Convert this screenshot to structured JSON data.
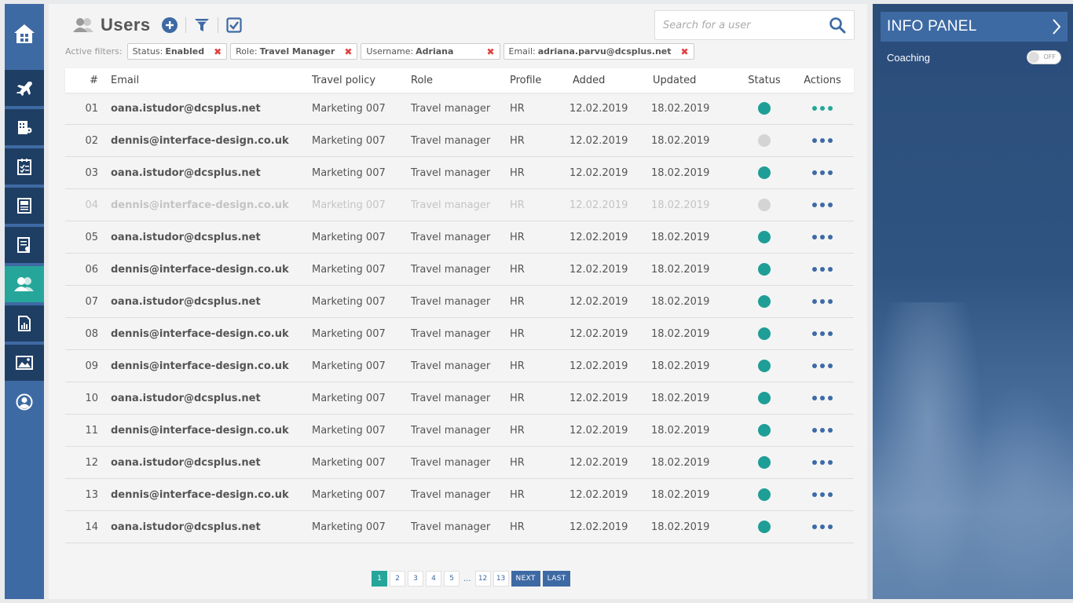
{
  "page": {
    "title": "Users"
  },
  "search": {
    "placeholder": "Search for a user"
  },
  "filters": {
    "label": "Active filters:",
    "items": [
      {
        "key": "Status:",
        "value": "Enabled"
      },
      {
        "key": "Role:",
        "value": "Travel Manager"
      },
      {
        "key": "Username:",
        "value": "Adriana"
      },
      {
        "key": "Email:",
        "value": "adriana.parvu@dcsplus.net"
      }
    ]
  },
  "table": {
    "headers": {
      "num": "#",
      "email": "Email",
      "policy": "Travel policy",
      "role": "Role",
      "profile": "Profile",
      "added": "Added",
      "updated": "Updated",
      "status": "Status",
      "actions": "Actions"
    },
    "rows": [
      {
        "num": "01",
        "email": "oana.istudor@dcsplus.net",
        "policy": "Marketing 007",
        "role": "Travel manager",
        "profile": "HR",
        "added": "12.02.2019",
        "updated": "18.02.2019",
        "status": "active"
      },
      {
        "num": "02",
        "email": "dennis@interface-design.co.uk",
        "policy": "Marketing 007",
        "role": "Travel manager",
        "profile": "HR",
        "added": "12.02.2019",
        "updated": "18.02.2019",
        "status": "inactive"
      },
      {
        "num": "03",
        "email": "oana.istudor@dcsplus.net",
        "policy": "Marketing 007",
        "role": "Travel manager",
        "profile": "HR",
        "added": "12.02.2019",
        "updated": "18.02.2019",
        "status": "active"
      },
      {
        "num": "04",
        "email": "dennis@interface-design.co.uk",
        "policy": "Marketing 007",
        "role": "Travel manager",
        "profile": "HR",
        "added": "12.02.2019",
        "updated": "18.02.2019",
        "status": "inactive"
      },
      {
        "num": "05",
        "email": "oana.istudor@dcsplus.net",
        "policy": "Marketing 007",
        "role": "Travel manager",
        "profile": "HR",
        "added": "12.02.2019",
        "updated": "18.02.2019",
        "status": "active"
      },
      {
        "num": "06",
        "email": "dennis@interface-design.co.uk",
        "policy": "Marketing 007",
        "role": "Travel manager",
        "profile": "HR",
        "added": "12.02.2019",
        "updated": "18.02.2019",
        "status": "active"
      },
      {
        "num": "07",
        "email": "oana.istudor@dcsplus.net",
        "policy": "Marketing 007",
        "role": "Travel manager",
        "profile": "HR",
        "added": "12.02.2019",
        "updated": "18.02.2019",
        "status": "active"
      },
      {
        "num": "08",
        "email": "dennis@interface-design.co.uk",
        "policy": "Marketing 007",
        "role": "Travel manager",
        "profile": "HR",
        "added": "12.02.2019",
        "updated": "18.02.2019",
        "status": "active"
      },
      {
        "num": "09",
        "email": "dennis@interface-design.co.uk",
        "policy": "Marketing 007",
        "role": "Travel manager",
        "profile": "HR",
        "added": "12.02.2019",
        "updated": "18.02.2019",
        "status": "active"
      },
      {
        "num": "10",
        "email": "oana.istudor@dcsplus.net",
        "policy": "Marketing 007",
        "role": "Travel manager",
        "profile": "HR",
        "added": "12.02.2019",
        "updated": "18.02.2019",
        "status": "active"
      },
      {
        "num": "11",
        "email": "dennis@interface-design.co.uk",
        "policy": "Marketing 007",
        "role": "Travel manager",
        "profile": "HR",
        "added": "12.02.2019",
        "updated": "18.02.2019",
        "status": "active"
      },
      {
        "num": "12",
        "email": "oana.istudor@dcsplus.net",
        "policy": "Marketing 007",
        "role": "Travel manager",
        "profile": "HR",
        "added": "12.02.2019",
        "updated": "18.02.2019",
        "status": "active"
      },
      {
        "num": "13",
        "email": "dennis@interface-design.co.uk",
        "policy": "Marketing 007",
        "role": "Travel manager",
        "profile": "HR",
        "added": "12.02.2019",
        "updated": "18.02.2019",
        "status": "active"
      },
      {
        "num": "14",
        "email": "oana.istudor@dcsplus.net",
        "policy": "Marketing 007",
        "role": "Travel manager",
        "profile": "HR",
        "added": "12.02.2019",
        "updated": "18.02.2019",
        "status": "active"
      }
    ]
  },
  "pagination": {
    "pages": [
      "1",
      "2",
      "3",
      "4",
      "5",
      "...",
      "12",
      "13"
    ],
    "current": "1",
    "next": "NEXT",
    "last": "LAST"
  },
  "info_panel": {
    "title": "INFO PANEL",
    "coaching_label": "Coaching",
    "coaching_toggle": "OFF"
  },
  "colors": {
    "primary": "#3e6aa4",
    "navy": "#1f3e64",
    "accent": "#26a69a",
    "status_active": "#1e9e96",
    "status_inactive": "#d4d4d4",
    "remove": "#e04040"
  },
  "icons": {
    "sidebar": [
      "home-icon",
      "flights-icon",
      "hotels-icon",
      "checklist-icon",
      "documents-icon",
      "reports-icon",
      "users-icon",
      "invoices-icon",
      "gallery-icon",
      "profile-icon"
    ],
    "toolbar": [
      "users-icon",
      "add-icon",
      "filter-icon",
      "checkbox-icon"
    ]
  }
}
